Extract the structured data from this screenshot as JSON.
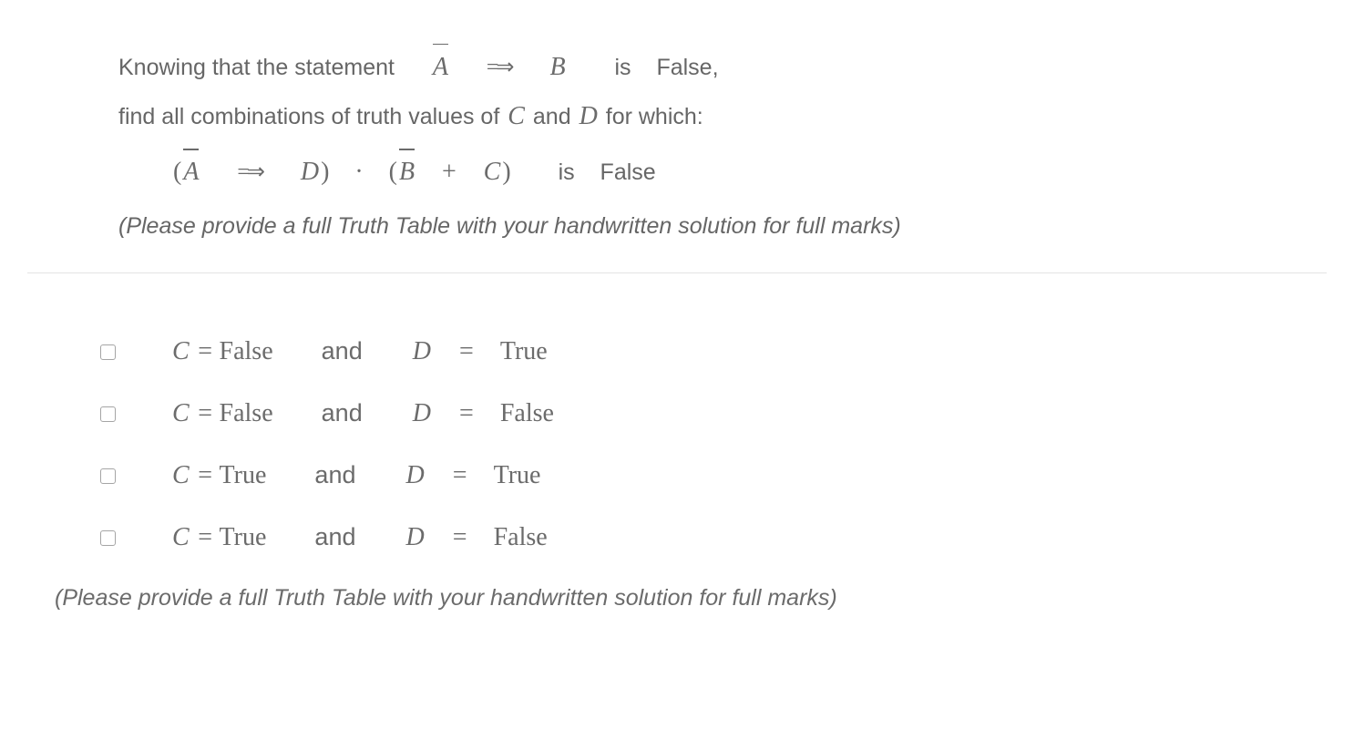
{
  "question": {
    "line1_prefix": "Knowing that the statement",
    "line1_is": "is",
    "line1_result": "False,",
    "line2": "find all combinations of truth values of",
    "line2_and": "and",
    "line2_suffix": "for which:",
    "line3_is": "is",
    "line3_result": "False",
    "note": "(Please provide a full Truth Table with your handwritten solution for full marks)"
  },
  "vars": {
    "A": "A",
    "B": "B",
    "C": "C",
    "D": "D"
  },
  "math": {
    "implies": "=⇒",
    "dot": "·",
    "plus": "+",
    "lparen": "(",
    "rparen": ")",
    "eq": "=",
    "True": "True",
    "False": "False",
    "and": "and"
  },
  "options": [
    {
      "c": "False",
      "d": "True"
    },
    {
      "c": "False",
      "d": "False"
    },
    {
      "c": "True",
      "d": "True"
    },
    {
      "c": "True",
      "d": "False"
    }
  ],
  "footer_note": "(Please provide a full Truth Table with your handwritten solution for full marks)"
}
